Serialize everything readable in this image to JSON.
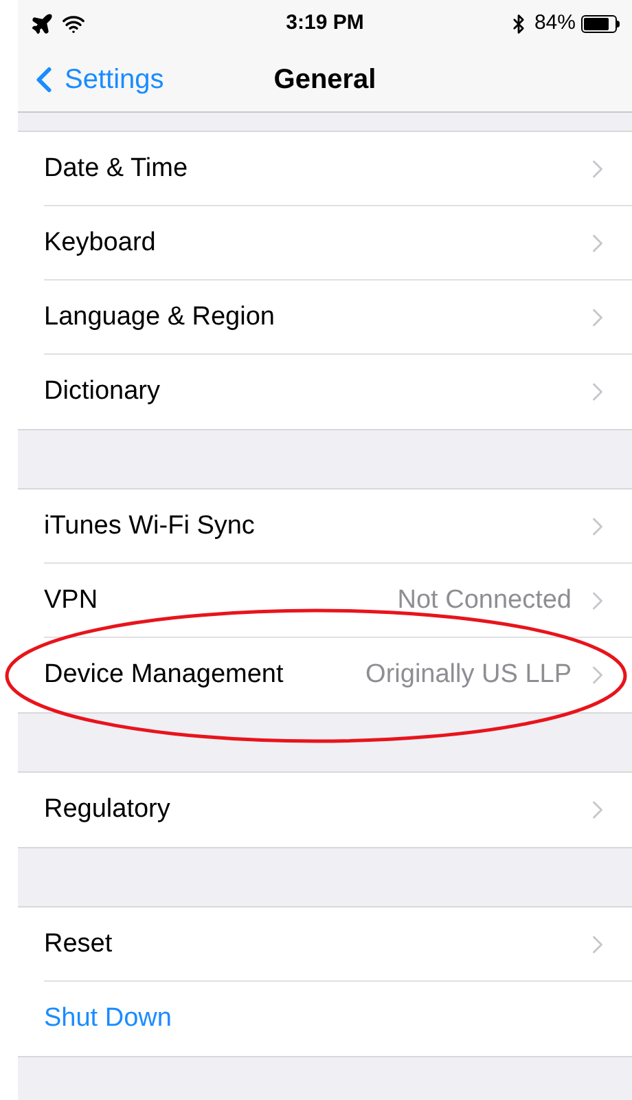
{
  "status_bar": {
    "time": "3:19 PM",
    "battery": "84%"
  },
  "nav_bar": {
    "back": "Settings",
    "title": "General"
  },
  "groups": [
    {
      "rows": [
        {
          "kind": "nav",
          "label": "Date & Time",
          "highlighted": false
        },
        {
          "kind": "nav",
          "label": "Keyboard",
          "highlighted": false
        },
        {
          "kind": "nav",
          "label": "Language & Region",
          "highlighted": false
        },
        {
          "kind": "nav",
          "label": "Dictionary",
          "highlighted": false
        }
      ]
    },
    {
      "rows": [
        {
          "kind": "nav",
          "label": "iTunes Wi-Fi Sync",
          "highlighted": false
        },
        {
          "kind": "nav",
          "label": "VPN",
          "value": "Not Connected",
          "highlighted": false
        },
        {
          "kind": "nav",
          "label": "Device Management",
          "value": "Originally US LLP",
          "highlighted": true
        }
      ]
    },
    {
      "rows": [
        {
          "kind": "nav",
          "label": "Regulatory",
          "highlighted": false
        }
      ]
    },
    {
      "rows": [
        {
          "kind": "nav",
          "label": "Reset",
          "highlighted": false
        },
        {
          "kind": "action",
          "label": "Shut Down",
          "highlighted": false
        }
      ]
    }
  ]
}
